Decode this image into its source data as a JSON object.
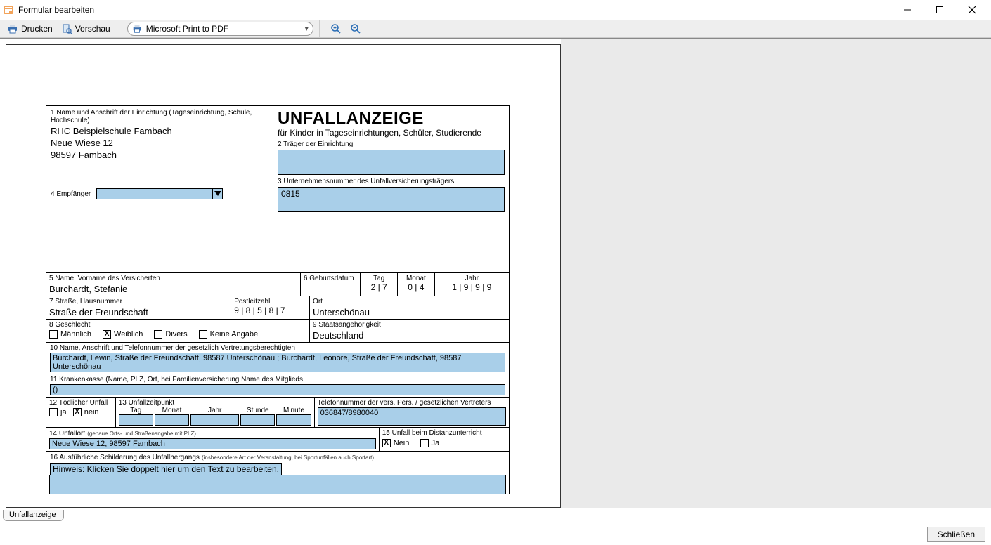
{
  "window": {
    "title": "Formular bearbeiten"
  },
  "toolbar": {
    "print": "Drucken",
    "preview": "Vorschau",
    "printer": "Microsoft Print to PDF"
  },
  "tab": {
    "label": "Unfallanzeige"
  },
  "footer": {
    "close": "Schließen"
  },
  "form": {
    "sec1_label": "1 Name und Anschrift der Einrichtung (Tageseinrichtung, Schule, Hochschule)",
    "school_name": "RHC Beispielschule Fambach",
    "school_street": "Neue Wiese 12",
    "school_city": "98597 Fambach",
    "sec4_label": "4 Empfänger",
    "title": "UNFALLANZEIGE",
    "subtitle": "für Kinder in Tageseinrichtungen, Schüler, Studierende",
    "sec2_label": "2 Träger der Einrichtung",
    "sec2_value": "",
    "sec3_label": "3 Unternehmensnummer des Unfallversicherungsträgers",
    "sec3_value": "0815",
    "sec5_label": "5 Name, Vorname des Versicherten",
    "sec5_value": "Burchardt, Stefanie",
    "sec6_label": "6 Geburtsdatum",
    "sec6_tag": "Tag",
    "sec6_mon": "Monat",
    "sec6_jahr": "Jahr",
    "sec6_tag_v": "2 | 7",
    "sec6_mon_v": "0 | 4",
    "sec6_jahr_v": "1 | 9 | 9 | 9",
    "sec7_label": "7 Straße, Hausnummer",
    "sec7_value": "Straße der Freundschaft",
    "sec7_plz_label": "Postleitzahl",
    "sec7_plz_value": "9 | 8 | 5 | 8 | 7",
    "sec7_ort_label": "Ort",
    "sec7_ort_value": "Unterschönau",
    "sec8_label": "8 Geschlecht",
    "sec8_m": "Männlich",
    "sec8_w": "Weiblich",
    "sec8_d": "Divers",
    "sec8_k": "Keine Angabe",
    "sec9_label": "9 Staatsangehörigkeit",
    "sec9_value": "Deutschland",
    "sec10_label": "10 Name, Anschrift und Telefonnummer der gesetzlich Vertretungsberechtigten",
    "sec10_value": "Burchardt, Lewin, Straße der Freundschaft, 98587 Unterschönau ; Burchardt, Leonore, Straße der Freundschaft, 98587 Unterschönau",
    "sec11_label": "11 Krankenkasse (Name, PLZ, Ort, bei Familienversicherung Name des Mitglieds",
    "sec11_value": "()",
    "sec12_label": "12 Tödlicher Unfall",
    "sec12_ja": "ja",
    "sec12_nein": "nein",
    "sec13_label": "13 Unfallzeitpunkt",
    "sec13_tag": "Tag",
    "sec13_mon": "Monat",
    "sec13_jahr": "Jahr",
    "sec13_std": "Stunde",
    "sec13_min": "Minute",
    "sec13_phone_label": "Telefonnummer der vers. Pers. / gesetzlichen Vertreters",
    "sec13_phone_value": "036847/8980040",
    "sec14_label": "14 Unfallort",
    "sec14_hint": "(genaue Orts- und Straßenangabe mit PLZ)",
    "sec14_value": "Neue Wiese 12, 98597 Fambach",
    "sec15_label": "15 Unfall beim Distanzunterricht",
    "sec15_nein": "Nein",
    "sec15_ja": "Ja",
    "sec16_label": "16 Ausführliche Schilderung des Unfallhergangs",
    "sec16_hint": "(insbesondere Art der Veranstaltung, bei Sportunfällen auch Sportart)",
    "sec16_placeholder": "Hinweis: Klicken Sie doppelt hier um den Text zu bearbeiten."
  }
}
